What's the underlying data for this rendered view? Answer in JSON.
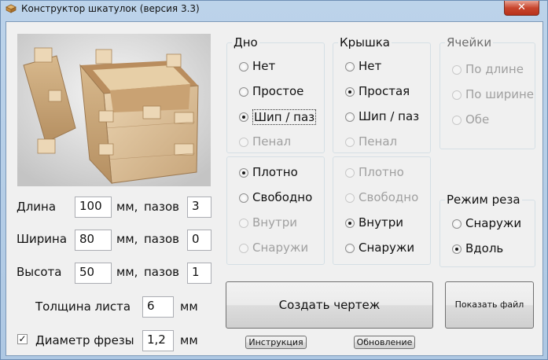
{
  "window": {
    "title": "Конструктор шкатулок (версия 3.3)",
    "close_label": "✕"
  },
  "dims": {
    "length_label": "Длина",
    "length_value": "100",
    "length_unit": "мм,",
    "length_slots_label": "пазов",
    "length_slots": "3",
    "width_label": "Ширина",
    "width_value": "80",
    "width_unit": "мм,",
    "width_slots_label": "пазов",
    "width_slots": "0",
    "height_label": "Высота",
    "height_value": "50",
    "height_unit": "мм,",
    "height_slots_label": "пазов",
    "height_slots": "1",
    "sheet_label": "Толщина листа",
    "sheet_value": "6",
    "sheet_unit": "мм",
    "cutter_label": "Диаметр фрезы",
    "cutter_value": "1,2",
    "cutter_unit": "мм",
    "cutter_checked": "✓"
  },
  "bottom": {
    "title": "Дно",
    "options": [
      "Нет",
      "Простое",
      "Шип / паз",
      "Пенал"
    ],
    "selected": "Шип / паз"
  },
  "lid": {
    "title": "Крышка",
    "options": [
      "Нет",
      "Простая",
      "Шип / паз",
      "Пенал"
    ],
    "selected": "Простая"
  },
  "cells": {
    "title": "Ячейки",
    "options": [
      "По длине",
      "По ширине",
      "Обе"
    ]
  },
  "fit_bottom": {
    "options": [
      "Плотно",
      "Свободно",
      "Внутри",
      "Снаружи"
    ],
    "selected": "Плотно"
  },
  "fit_lid": {
    "options": [
      "Плотно",
      "Свободно",
      "Внутри",
      "Снаружи"
    ],
    "selected": "Внутри"
  },
  "cut_mode": {
    "title": "Режим реза",
    "options": [
      "Снаружи",
      "Вдоль"
    ],
    "selected": "Вдоль"
  },
  "buttons": {
    "create": "Создать чертеж",
    "show_file": "Показать файл",
    "instructions": "Инструкция",
    "update": "Обновление"
  }
}
